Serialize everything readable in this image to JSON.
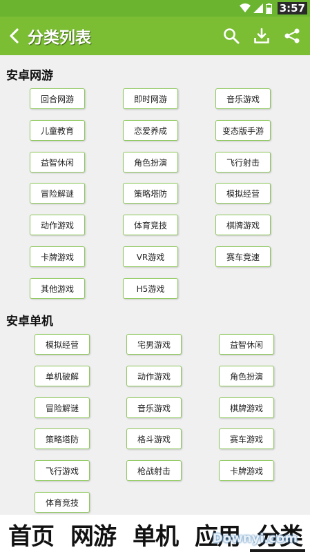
{
  "status": {
    "time": "3:57"
  },
  "appbar": {
    "title": "分类列表"
  },
  "sections": [
    {
      "title": "安卓网游",
      "items": [
        "回合网游",
        "即时网游",
        "音乐游戏",
        "儿童教育",
        "恋爱养成",
        "变态版手游",
        "益智休闲",
        "角色扮演",
        "飞行射击",
        "冒险解谜",
        "策略塔防",
        "模拟经营",
        "动作游戏",
        "体育竞技",
        "棋牌游戏",
        "卡牌游戏",
        "VR游戏",
        "赛车竞速",
        "其他游戏",
        "H5游戏"
      ]
    },
    {
      "title": "安卓单机",
      "items": [
        "模拟经营",
        "宅男游戏",
        "益智休闲",
        "单机破解",
        "动作游戏",
        "角色扮演",
        "冒险解谜",
        "音乐游戏",
        "棋牌游戏",
        "策略塔防",
        "格斗游戏",
        "赛车游戏",
        "飞行游戏",
        "枪战射击",
        "卡牌游戏",
        "体育竞技"
      ]
    }
  ],
  "bottom_nav": [
    "首页",
    "网游",
    "单机",
    "应用",
    "分类"
  ],
  "watermark": "Downyi.com",
  "colors": {
    "status_bar": "#6ab42f",
    "app_bar": "#7bbd33",
    "tag_border": "#8cc85a"
  }
}
